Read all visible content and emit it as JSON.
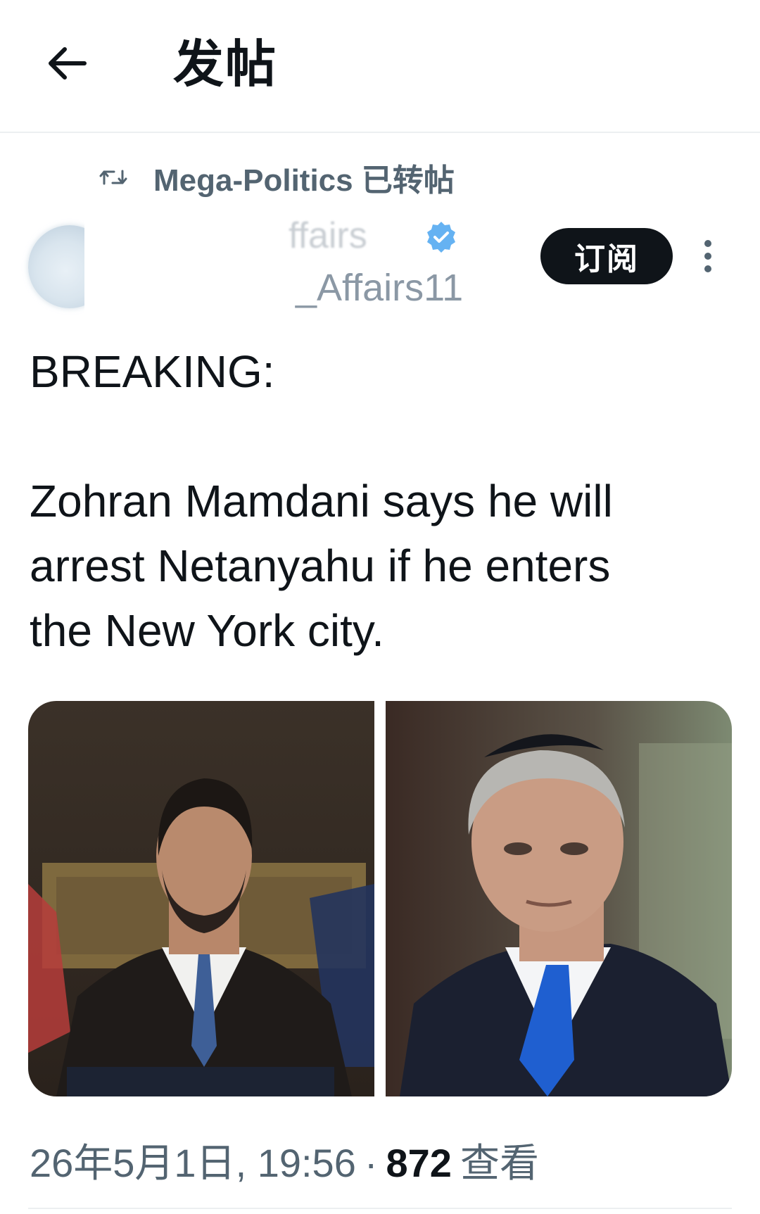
{
  "header": {
    "title": "发帖",
    "back_icon": "arrow-left-icon"
  },
  "repost": {
    "icon": "repost-icon",
    "text": "Mega-Politics 已转帖"
  },
  "author": {
    "display_name": "ffairs",
    "handle": "_Affairs11",
    "verified_icon": "verified-badge-icon",
    "verified_color": "#4aa4f0"
  },
  "actions": {
    "follow_label": "订阅",
    "more_icon": "more-vertical-icon"
  },
  "tweet": {
    "headline": "BREAKING:",
    "lines": [
      "Zohran Mamdani says he will",
      "arrest Netanyahu if he enters",
      "the New York city."
    ]
  },
  "media": {
    "count": 2
  },
  "meta": {
    "timestamp": "26年5月1日, 19:56",
    "separator": "·",
    "views_count": "872",
    "views_label": "查看"
  },
  "colors": {
    "text_primary": "#0f1419",
    "text_secondary": "#536471",
    "button_bg": "#0f1419"
  }
}
